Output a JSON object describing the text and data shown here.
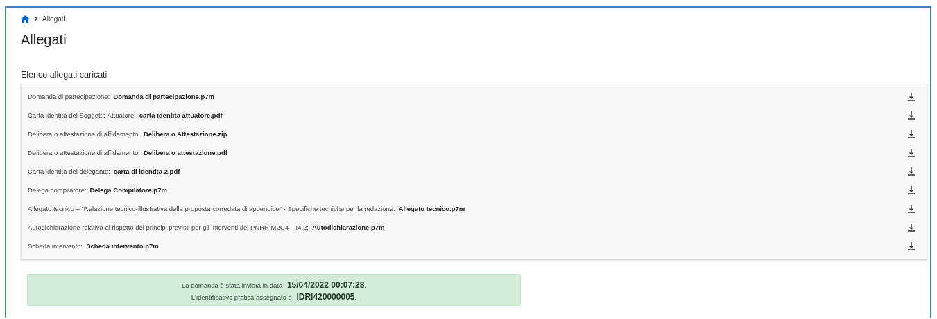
{
  "breadcrumb": {
    "items": [
      "Allegati"
    ]
  },
  "title": "Allegati",
  "section_title": "Elenco allegati caricati",
  "attachments": [
    {
      "label": "Domanda di partecipazione:",
      "file": "Domanda di partecipazione.p7m"
    },
    {
      "label": "Carta identità del Soggetto Attuatore:",
      "file": "carta identita attuatore.pdf"
    },
    {
      "label": "Delibera o attestazione di affidamento:",
      "file": "Delibera o Attestazione.zip"
    },
    {
      "label": "Delibera o attestazione di affidamento:",
      "file": "Delibera o attestazione.pdf"
    },
    {
      "label": "Carta identità del delegante:",
      "file": "carta di identita 2.pdf"
    },
    {
      "label": "Delega compilatore:",
      "file": "Delega Compilatore.p7m"
    },
    {
      "label": "Allegato tecnico – “Relazione tecnico-illustrativa della proposta corredata di appendice” - Specifiche tecniche per la redazione:",
      "file": "Allegato tecnico.p7m"
    },
    {
      "label": "Autodichiarazione relativa al rispetto dei principi previsti per gli interventi del PNRR M2C4 – I4.2:",
      "file": "Autodichiarazione.p7m"
    },
    {
      "label": "Scheda intervento:",
      "file": "Scheda intervento.p7m"
    }
  ],
  "alert": {
    "lines": [
      "La domanda è stata inviata in data **15/04/2022 00:07:28**.",
      "L'identificativo pratica assegnato è **IDRI420000005**."
    ]
  }
}
